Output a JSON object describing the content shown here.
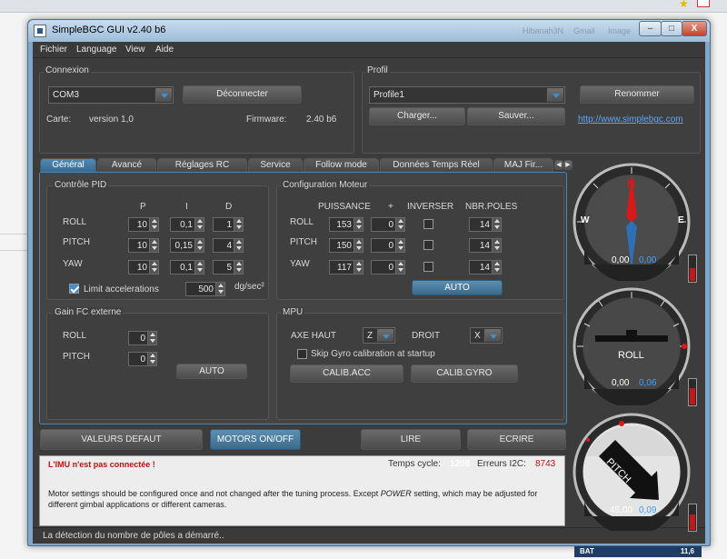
{
  "window": {
    "title": "SimpleBGC GUI v2.40 b6",
    "faded_labels": [
      "Hibanah3N",
      "Gmail",
      "Image"
    ],
    "min": "–",
    "max": "□",
    "close": "X"
  },
  "menu": [
    "Fichier",
    "Language",
    "View",
    "Aide"
  ],
  "connexion": {
    "title": "Connexion",
    "port": "COM3",
    "disconnect": "Déconnecter",
    "board_label": "Carte:",
    "board_value": "version 1,0",
    "firmware_label": "Firmware:",
    "firmware_value": "2.40 b6"
  },
  "profil": {
    "title": "Profil",
    "profile": "Profile1",
    "rename": "Renommer",
    "load": "Charger...",
    "save": "Sauver...",
    "link": "http://www.simplebgc.com"
  },
  "tabs": [
    "Général",
    "Avancé",
    "Réglages RC",
    "Service",
    "Follow mode",
    "Données Temps Réel",
    "MAJ Fir..."
  ],
  "pid": {
    "title": "Contrôle PID",
    "headers": [
      "P",
      "I",
      "D"
    ],
    "rows": [
      {
        "axis": "ROLL",
        "p": "10",
        "i": "0,1",
        "d": "1"
      },
      {
        "axis": "PITCH",
        "p": "10",
        "i": "0,15",
        "d": "4"
      },
      {
        "axis": "YAW",
        "p": "10",
        "i": "0,1",
        "d": "5"
      }
    ],
    "limit_label": "Limit accelerations",
    "limit_checked": true,
    "limit_value": "500",
    "limit_unit": "dg/sec²"
  },
  "motor": {
    "title": "Configuration Moteur",
    "headers": [
      "PUISSANCE",
      "+",
      "INVERSER",
      "NBR.POLES"
    ],
    "rows": [
      {
        "axis": "ROLL",
        "power": "153",
        "offset": "0",
        "inverse": false,
        "poles": "14"
      },
      {
        "axis": "PITCH",
        "power": "150",
        "offset": "0",
        "inverse": false,
        "poles": "14"
      },
      {
        "axis": "YAW",
        "power": "117",
        "offset": "0",
        "inverse": false,
        "poles": "14"
      }
    ],
    "auto": "AUTO"
  },
  "gain": {
    "title": "Gain FC externe",
    "rows": [
      {
        "axis": "ROLL",
        "value": "0"
      },
      {
        "axis": "PITCH",
        "value": "0"
      }
    ],
    "auto": "AUTO"
  },
  "mpu": {
    "title": "MPU",
    "top_label": "AXE HAUT",
    "top_value": "Z",
    "right_label": "DROIT",
    "right_value": "X",
    "skip_label": "Skip Gyro calibration at startup",
    "skip_checked": false,
    "calib_acc": "CALIB.ACC",
    "calib_gyro": "CALIB.GYRO"
  },
  "actions": {
    "defaults": "VALEURS DEFAUT",
    "motors": "MOTORS ON/OFF",
    "read": "LIRE",
    "write": "ECRIRE"
  },
  "status": {
    "error": "L'IMU n'est pas connectée !",
    "cycle_label": "Temps cycle:",
    "cycle_value": "1208",
    "i2c_label": "Erreurs I2C:",
    "i2c_value": "8743",
    "message": "Motor settings should be configured once and not changed after the tuning process. Except",
    "message_em": "POWER",
    "message_end": "setting, which may be adjusted for different gimbal applications or different cameras."
  },
  "statusbar": "La détection du nombre de pôles a démarré..",
  "battery": {
    "label": "BAT",
    "value": "11,6"
  },
  "gauges": {
    "compass": {
      "letters": [
        "N",
        "W",
        "E"
      ],
      "value": "0,00",
      "rate": "0,00",
      "level": 0.45
    },
    "roll": {
      "label": "ROLL",
      "value": "0,00",
      "rate": "0,06",
      "level": 0.6
    },
    "pitch": {
      "label": "PITCH",
      "value": "45,00",
      "rate": "0,09",
      "level": 0.55
    }
  },
  "colors": {
    "accent": "#3d8fd0",
    "error": "#c01010",
    "battery_bg": "#1f3d64"
  }
}
